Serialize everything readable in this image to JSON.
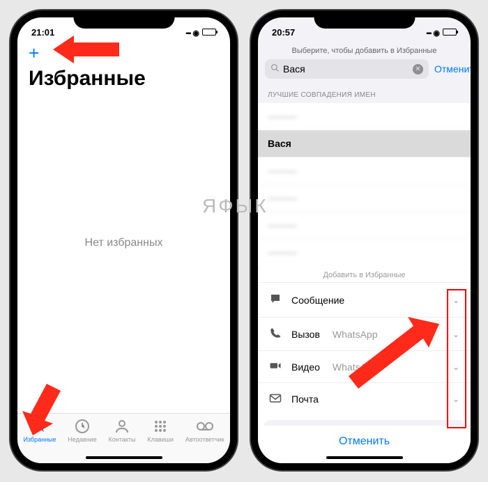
{
  "watermark": "ЯФЫК",
  "left": {
    "time": "21:01",
    "add_symbol": "+",
    "title": "Избранные",
    "empty": "Нет избранных",
    "tabs": [
      {
        "label": "Избранные"
      },
      {
        "label": "Недавние"
      },
      {
        "label": "Контакты"
      },
      {
        "label": "Клавиши"
      },
      {
        "label": "Автоответчик"
      }
    ]
  },
  "right": {
    "time": "20:57",
    "picker_title": "Выберите, чтобы добавить в Избранные",
    "search_value": "Вася",
    "cancel": "Отменить",
    "section": "ЛУЧШИЕ СОВПАДЕНИЯ ИМЕН",
    "contacts": [
      {
        "name": "———",
        "blur": true
      },
      {
        "name": "Вася",
        "selected": true
      },
      {
        "name": "———",
        "blur": true
      },
      {
        "name": "———",
        "blur": true
      },
      {
        "name": "———",
        "blur": true
      },
      {
        "name": "———",
        "blur": true
      }
    ],
    "sheet": {
      "title": "Добавить в Избранные",
      "actions": [
        {
          "label": "Сообщение",
          "sub": "",
          "icon": "message"
        },
        {
          "label": "Вызов",
          "sub": "WhatsApp",
          "icon": "phone"
        },
        {
          "label": "Видео",
          "sub": "WhatsApp",
          "icon": "video"
        },
        {
          "label": "Почта",
          "sub": "",
          "icon": "mail"
        }
      ],
      "cancel": "Отменить"
    }
  }
}
